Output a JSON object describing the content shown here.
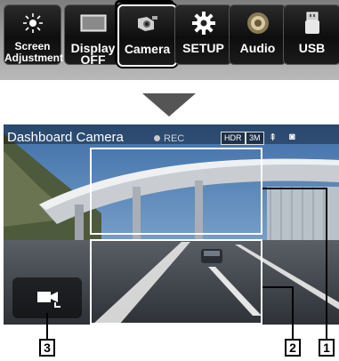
{
  "menu": {
    "items": [
      {
        "label": "Screen Adjustment",
        "icon": "screen-adjust-icon"
      },
      {
        "label": "Display OFF",
        "icon": "display-off-icon"
      },
      {
        "label": "Camera",
        "icon": "camera-icon",
        "selected": true
      },
      {
        "label": "SETUP",
        "icon": "gear-icon"
      },
      {
        "label": "Audio",
        "icon": "speaker-icon"
      },
      {
        "label": "USB",
        "icon": "usb-icon"
      }
    ]
  },
  "camera_screen": {
    "title": "Dashboard Camera",
    "rec_label": "REC",
    "chip_hdr": "HDR",
    "chip_res": "3M"
  },
  "callouts": {
    "label_1": "1",
    "label_2": "2",
    "label_3": "3"
  }
}
